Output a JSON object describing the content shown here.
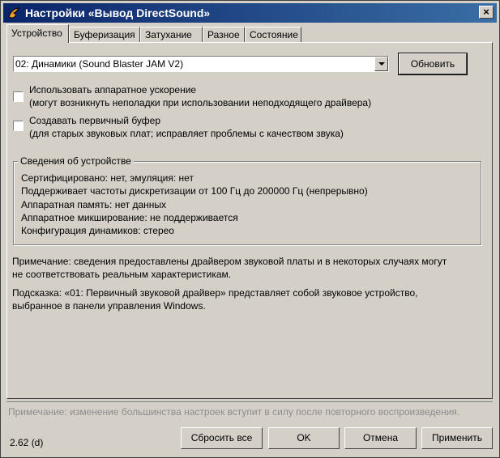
{
  "window": {
    "title": "Настройки «Вывод DirectSound»",
    "icon": "foobar-icon",
    "close_label": "×"
  },
  "tabs": [
    {
      "label": "Устройство",
      "active": true
    },
    {
      "label": "Буферизация",
      "active": false
    },
    {
      "label": "Затухание",
      "active": false
    },
    {
      "label": "Разное",
      "active": false
    },
    {
      "label": "Состояние",
      "active": false
    }
  ],
  "device": {
    "selected": "02: Динамики (Sound Blaster JAM V2)",
    "refresh_label": "Обновить"
  },
  "options": [
    {
      "label": "Использовать аппаратное ускорение",
      "hint": "(могут возникнуть неполадки при использовании неподходящего драйвера)",
      "checked": false
    },
    {
      "label": "Создавать первичный буфер",
      "hint": "(для старых звуковых плат; исправляет проблемы с качеством звука)",
      "checked": false
    }
  ],
  "device_info": {
    "title": "Сведения об устройстве",
    "lines": [
      "Сертифицировано: нет, эмуляция: нет",
      "Поддерживает частоты дискретизации от 100 Гц до 200000 Гц (непрерывно)",
      "Аппаратная память: нет данных",
      "Аппаратное микширование: не поддерживается",
      "Конфигурация динамиков: стерео"
    ]
  },
  "notes": {
    "note_line1": "Примечание: сведения предоставлены драйвером звуковой платы и в некоторых случаях могут",
    "note_line2": "не соответствовать реальным характеристикам.",
    "hint_line1": "Подсказка: «01: Первичный звуковой драйвер» представляет собой звуковое устройство,",
    "hint_line2": "выбранное в панели управления Windows."
  },
  "footer": {
    "restart_note": "Примечание: изменение большинства настроек вступит в силу после повторного воспроизведения.",
    "version": "2.62 (d)",
    "reset_label": "Сбросить все",
    "ok_label": "OK",
    "cancel_label": "Отмена",
    "apply_label": "Применить"
  },
  "colors": {
    "titlebar_start": "#0a246a",
    "titlebar_end": "#3a6ea5",
    "face": "#d4d0c8",
    "disabled_text": "#8c8c8c"
  }
}
